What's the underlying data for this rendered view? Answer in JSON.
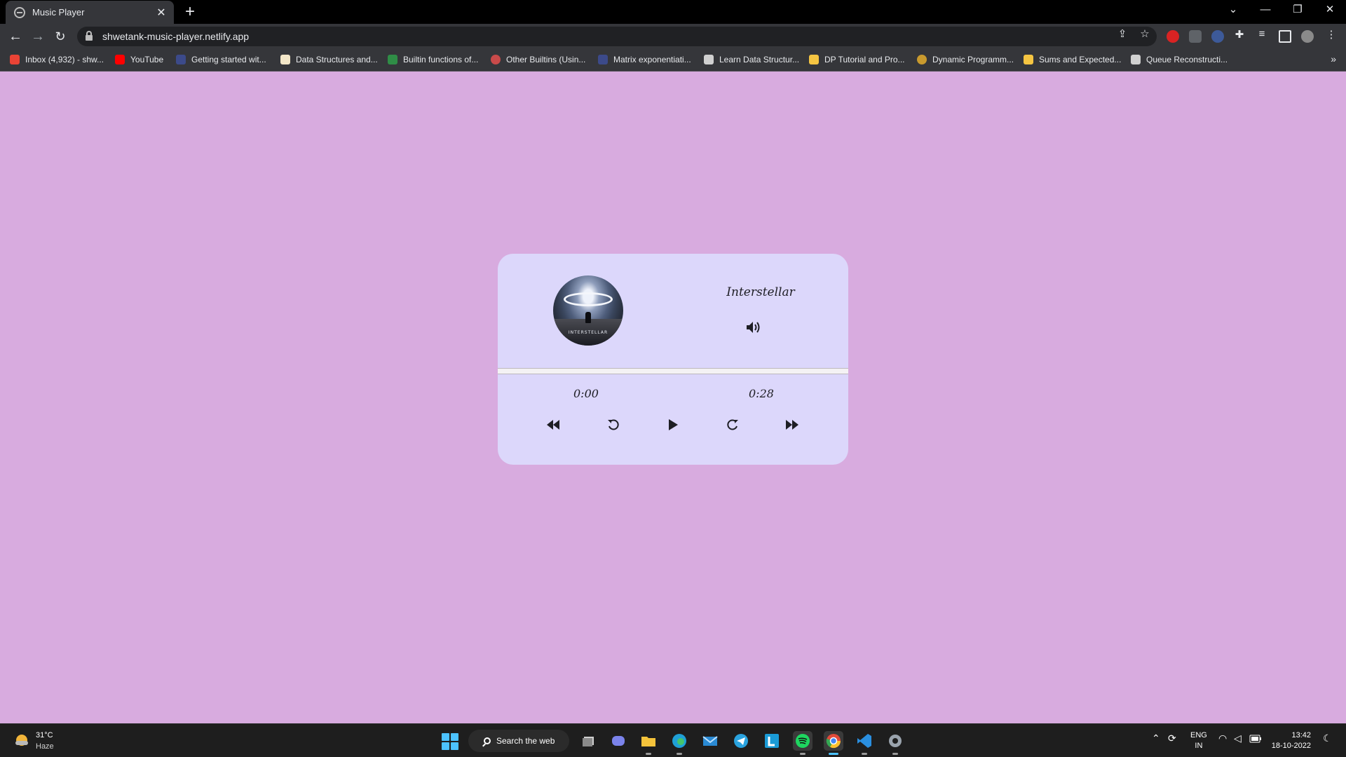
{
  "browser": {
    "tab_title": "Music Player",
    "tab_close": "✕",
    "new_tab": "+",
    "url": "shwetank-music-player.netlify.app",
    "window_controls": {
      "tab_search": "⌄",
      "minimize": "—",
      "restore": "❐",
      "close": "✕"
    },
    "bookmarks": [
      {
        "label": "Inbox (4,932) - shw...",
        "icon": "gmail-icon",
        "color": "#ea4335"
      },
      {
        "label": "YouTube",
        "icon": "youtube-icon",
        "color": "#ff0000"
      },
      {
        "label": "Getting started wit...",
        "icon": "globe-icon",
        "color": "#3c4a8a"
      },
      {
        "label": "Data Structures and...",
        "icon": "bookmark-icon",
        "color": "#f2e6c8"
      },
      {
        "label": "Builtin functions of...",
        "icon": "gfg-icon",
        "color": "#2f8d46"
      },
      {
        "label": "Other Builtins (Usin...",
        "icon": "gcc-icon",
        "color": "#c94a4a"
      },
      {
        "label": "Matrix exponentiati...",
        "icon": "globe-icon",
        "color": "#3c4a8a"
      },
      {
        "label": "Learn Data Structur...",
        "icon": "cc-icon",
        "color": "#d0d0d0"
      },
      {
        "label": "DP Tutorial and Pro...",
        "icon": "codeforces-icon",
        "color": "#f5c542"
      },
      {
        "label": "Dynamic Programm...",
        "icon": "tutorial-icon",
        "color": "#c99a2e"
      },
      {
        "label": "Sums and Expected...",
        "icon": "codeforces-icon",
        "color": "#f5c542"
      },
      {
        "label": "Queue Reconstructi...",
        "icon": "book-icon",
        "color": "#d0d0d0"
      }
    ],
    "bookmarks_more": "»"
  },
  "player": {
    "song_title": "Interstellar",
    "album_art_text": "INTERSTELLAR",
    "current_time": "0:00",
    "duration": "0:28",
    "progress_fraction": 0.0,
    "accent_color": "#9a8fd9",
    "card_color": "#dcd7fb",
    "background_color": "#d8abdf",
    "controls": [
      "rewind-icon",
      "replay-icon",
      "play-icon",
      "redo-icon",
      "fast-forward-icon"
    ]
  },
  "taskbar": {
    "weather_temp": "31°C",
    "weather_condition": "Haze",
    "search_text": "Search the web",
    "lang_top": "ENG",
    "lang_bottom": "IN",
    "time": "13:42",
    "date": "18-10-2022",
    "apps": [
      "file-explorer-icon",
      "teams-icon",
      "folder-icon",
      "edge-icon",
      "mail-icon",
      "telegram-icon",
      "lens-icon",
      "spotify-icon",
      "chrome-icon",
      "vscode-icon",
      "settings-icon"
    ]
  }
}
